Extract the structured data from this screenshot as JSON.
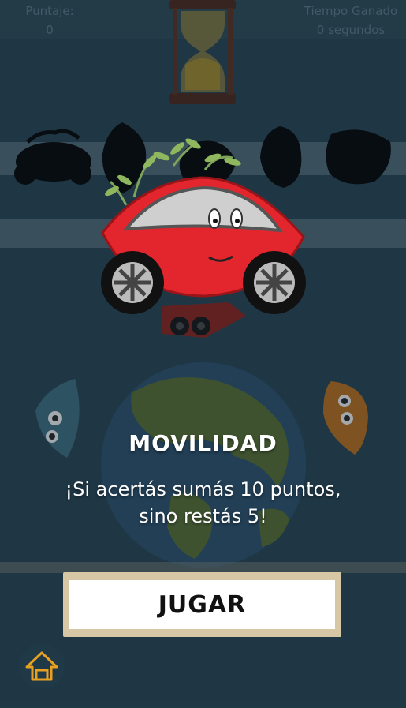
{
  "hud": {
    "score_label": "Puntaje:",
    "score_value": "0",
    "time_label": "Tiempo Ganado",
    "time_value": "0 segundos"
  },
  "modal": {
    "category": "MOVILIDAD",
    "rule_line1": "¡Si acertás sumás 10 puntos,",
    "rule_line2": "sino restás 5!",
    "play_label": "JUGAR"
  },
  "colors": {
    "background": "#264150",
    "car_red": "#e3262e",
    "frame": "#d8c7a4",
    "text": "#ffffff"
  },
  "icons": [
    "hourglass-icon",
    "car-character-icon",
    "globe-icon",
    "home-icon"
  ]
}
